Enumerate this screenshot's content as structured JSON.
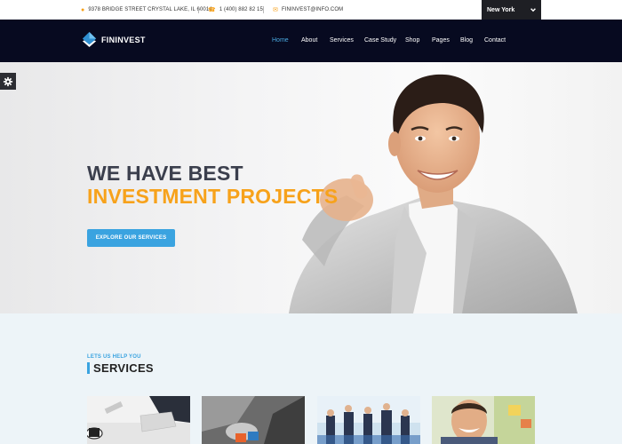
{
  "topbar": {
    "address": "9378 BRIDGE STREET CRYSTAL LAKE, IL 60014",
    "phone": "1 (400) 882 82 15",
    "email": "FININVEST@INFO.COM",
    "city_selected": "New York"
  },
  "brand": {
    "name": "FININVEST"
  },
  "nav": {
    "items": [
      {
        "label": "Home",
        "active": true
      },
      {
        "label": "About"
      },
      {
        "label": "Services"
      },
      {
        "label": "Case Study"
      },
      {
        "label": "Shop"
      },
      {
        "label": "Pages"
      },
      {
        "label": "Blog"
      },
      {
        "label": "Contact"
      }
    ]
  },
  "hero": {
    "line1": "WE HAVE BEST",
    "line2": "INVESTMENT PROJECTS",
    "cta": "EXPLORE OUR SERVICES"
  },
  "services": {
    "kicker": "LETS US HELP YOU",
    "title": "SERVICES",
    "thumbs": [
      "office-desk-photo",
      "puzzle-handshake-photo",
      "business-team-photo",
      "smiling-man-photo"
    ]
  },
  "colors": {
    "accent_blue": "#3aa3e0",
    "accent_orange": "#f7a21b",
    "nav_bg": "#070a20",
    "heading_dark": "#3b3f4d"
  }
}
